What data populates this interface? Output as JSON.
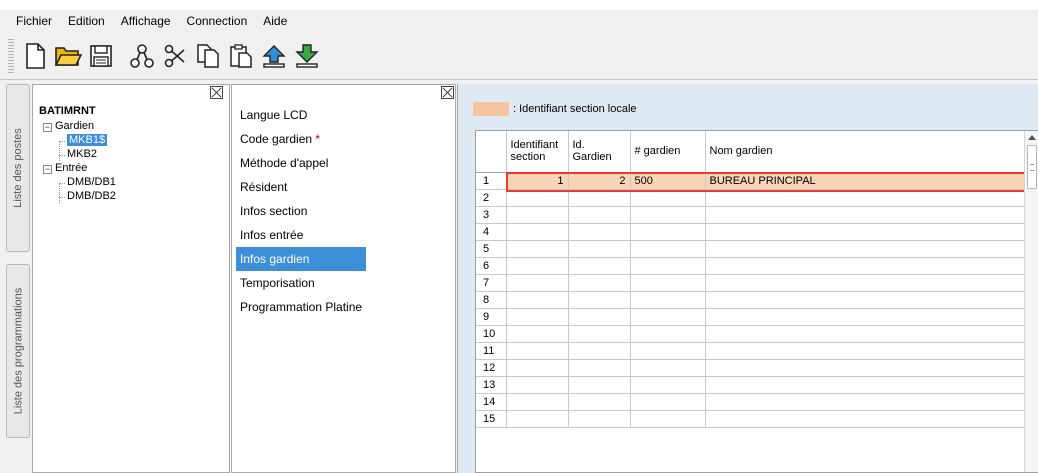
{
  "menu": [
    "Fichier",
    "Edition",
    "Affichage",
    "Connection",
    "Aide"
  ],
  "toolbar": {
    "icons": [
      "new-file-icon",
      "open-folder-icon",
      "save-icon",
      "connect-icon",
      "cut-icon",
      "copy-icon",
      "paste-icon",
      "upload-icon",
      "download-icon"
    ],
    "colors": {
      "folder": "#f0b400",
      "upload": "#2f8fd6",
      "download": "#3aa64a"
    }
  },
  "side_tabs": {
    "postes": "Liste des postes",
    "programmations": "Liste des programmations"
  },
  "tree": {
    "root": "BATIMRNT",
    "gardien": {
      "label": "Gardien",
      "children": [
        "MKB1$",
        "MKB2"
      ]
    },
    "entree": {
      "label": "Entrée",
      "children": [
        "DMB/DB1",
        "DMB/DB2"
      ]
    },
    "expander": "−"
  },
  "menu_list": {
    "items": [
      "Langue LCD",
      "Code gardien",
      "Méthode d'appel",
      "Résident",
      "Infos section",
      "Infos entrée",
      "Infos gardien",
      "Temporisation",
      "Programmation Platine"
    ],
    "required_marker": "*",
    "active": "Infos gardien"
  },
  "legend": {
    "text": ": Identifiant section locale",
    "color": "#f6c4a0"
  },
  "grid": {
    "headers": [
      "Identifiant section",
      "Id. Gardien",
      "# gardien",
      "Nom gardien"
    ],
    "row1": {
      "num": "1",
      "identifiant": "1",
      "id_gardien": "2",
      "gardien": "500",
      "nom": "BUREAU PRINCIPAL"
    },
    "row_numbers": [
      "2",
      "3",
      "4",
      "5",
      "6",
      "7",
      "8",
      "9",
      "10",
      "11",
      "12",
      "13",
      "14",
      "15"
    ],
    "highlight_color": "#f9d4b6",
    "outline_color": "#e83a31"
  }
}
